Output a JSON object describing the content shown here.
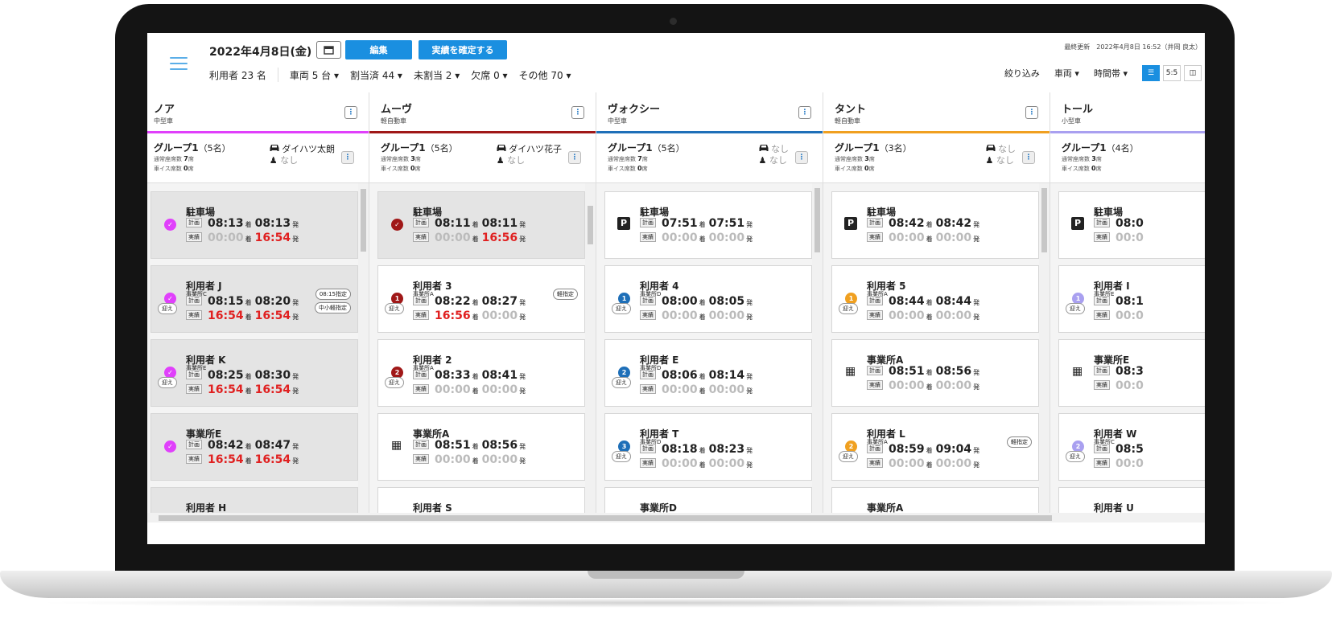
{
  "header": {
    "date": "2022年4月8日(金)",
    "edit_label": "編集",
    "confirm_label": "実績を確定する",
    "updated": "最終更新　2022年4月8日 16:52（井岡 良太）",
    "summary": {
      "users": "利用者 23 名",
      "vehicles": "車両 5 台 ▾",
      "assigned": "割当済 44 ▾",
      "unassigned": "未割当 2 ▾",
      "absent": "欠席 0 ▾",
      "other": "その他 70 ▾"
    },
    "filters": {
      "narrow": "絞り込み",
      "vehicle": "車両 ▾",
      "timeslot": "時間帯 ▾",
      "view_list": "☰",
      "view_55": "5:5",
      "view_book": "◫"
    }
  },
  "labels": {
    "plan": "計画",
    "actual": "実績",
    "arrive": "着",
    "depart": "発",
    "pickup": "迎え"
  },
  "colors": {
    "accent": "#1a8fe0",
    "red": "#e02020"
  },
  "columns": [
    {
      "name": "ノア",
      "type": "中型車",
      "color": "#e040fb",
      "group": {
        "name": "グループ1",
        "count": "（5名）",
        "normal_seats_label": "通常座席数",
        "normal_seats": "7",
        "wheel_label": "車イス席数",
        "wheel_seats": "0",
        "seat_unit": "席",
        "driver": "ダイハツ太朗",
        "helper": "なし"
      },
      "cards": [
        {
          "title": "駐車場",
          "sub": "",
          "marker": "check",
          "plan_arr": "08:13",
          "plan_dep": "08:13",
          "act_arr": "00:00",
          "act_dep": "16:54",
          "done": true
        },
        {
          "title": "利用者 J",
          "sub": "事業所C",
          "marker": "check",
          "pickup": true,
          "plan_arr": "08:15",
          "plan_dep": "08:20",
          "act_arr": "16:54",
          "act_dep": "16:54",
          "tag1": "08:15指定",
          "tag2": "中小軽指定",
          "done": true
        },
        {
          "title": "利用者 K",
          "sub": "事業所E",
          "marker": "check",
          "pickup": true,
          "plan_arr": "08:25",
          "plan_dep": "08:30",
          "act_arr": "16:54",
          "act_dep": "16:54",
          "done": true
        },
        {
          "title": "事業所E",
          "sub": "",
          "marker": "check",
          "plan_arr": "08:42",
          "plan_dep": "08:47",
          "act_arr": "16:54",
          "act_dep": "16:54",
          "done": true
        },
        {
          "title": "利用者 H",
          "sub": "",
          "marker": "check",
          "done": true
        }
      ]
    },
    {
      "name": "ムーヴ",
      "type": "軽自動車",
      "color": "#a01818",
      "group": {
        "name": "グループ1",
        "count": "（5名）",
        "normal_seats_label": "通常座席数",
        "normal_seats": "3",
        "wheel_label": "車イス席数",
        "wheel_seats": "0",
        "seat_unit": "席",
        "driver": "ダイハツ花子",
        "helper": "なし"
      },
      "cards": [
        {
          "title": "駐車場",
          "sub": "",
          "marker": "check",
          "plan_arr": "08:11",
          "plan_dep": "08:11",
          "act_arr": "00:00",
          "act_dep": "16:56",
          "done": true
        },
        {
          "title": "利用者 3",
          "sub": "事業所A",
          "marker": "1",
          "pickup": true,
          "plan_arr": "08:22",
          "plan_dep": "08:27",
          "act_arr": "16:56",
          "act_dep": "00:00",
          "tag1": "軽指定"
        },
        {
          "title": "利用者 2",
          "sub": "事業所A",
          "marker": "2",
          "pickup": true,
          "plan_arr": "08:33",
          "plan_dep": "08:41",
          "act_arr": "00:00",
          "act_dep": "00:00"
        },
        {
          "title": "事業所A",
          "sub": "",
          "marker": "building",
          "plan_arr": "08:51",
          "plan_dep": "08:56",
          "act_arr": "00:00",
          "act_dep": "00:00"
        },
        {
          "title": "利用者 S",
          "sub": "",
          "marker": "3"
        }
      ]
    },
    {
      "name": "ヴォクシー",
      "type": "中型車",
      "color": "#1e6fb8",
      "group": {
        "name": "グループ1",
        "count": "（5名）",
        "normal_seats_label": "通常座席数",
        "normal_seats": "7",
        "wheel_label": "車イス席数",
        "wheel_seats": "0",
        "seat_unit": "席",
        "driver": "なし",
        "helper": "なし"
      },
      "cards": [
        {
          "title": "駐車場",
          "sub": "",
          "marker": "parking",
          "plan_arr": "07:51",
          "plan_dep": "07:51",
          "act_arr": "00:00",
          "act_dep": "00:00"
        },
        {
          "title": "利用者 4",
          "sub": "事業所D",
          "marker": "1",
          "pickup": true,
          "plan_arr": "08:00",
          "plan_dep": "08:05",
          "act_arr": "00:00",
          "act_dep": "00:00"
        },
        {
          "title": "利用者 E",
          "sub": "事業所D",
          "marker": "2",
          "pickup": true,
          "plan_arr": "08:06",
          "plan_dep": "08:14",
          "act_arr": "00:00",
          "act_dep": "00:00"
        },
        {
          "title": "利用者 T",
          "sub": "事業所D",
          "marker": "3",
          "pickup": true,
          "plan_arr": "08:18",
          "plan_dep": "08:23",
          "act_arr": "00:00",
          "act_dep": "00:00"
        },
        {
          "title": "事業所D",
          "sub": "",
          "marker": "building"
        }
      ]
    },
    {
      "name": "タント",
      "type": "軽自動車",
      "color": "#f0a020",
      "group": {
        "name": "グループ1",
        "count": "（3名）",
        "normal_seats_label": "通常座席数",
        "normal_seats": "3",
        "wheel_label": "車イス席数",
        "wheel_seats": "0",
        "seat_unit": "席",
        "driver": "なし",
        "helper": "なし"
      },
      "cards": [
        {
          "title": "駐車場",
          "sub": "",
          "marker": "parking",
          "plan_arr": "08:42",
          "plan_dep": "08:42",
          "act_arr": "00:00",
          "act_dep": "00:00"
        },
        {
          "title": "利用者 5",
          "sub": "事業所A",
          "marker": "1",
          "pickup": true,
          "plan_arr": "08:44",
          "plan_dep": "08:44",
          "act_arr": "00:00",
          "act_dep": "00:00"
        },
        {
          "title": "事業所A",
          "sub": "",
          "marker": "building",
          "plan_arr": "08:51",
          "plan_dep": "08:56",
          "act_arr": "00:00",
          "act_dep": "00:00"
        },
        {
          "title": "利用者 L",
          "sub": "事業所A",
          "marker": "2",
          "pickup": true,
          "plan_arr": "08:59",
          "plan_dep": "09:04",
          "act_arr": "00:00",
          "act_dep": "00:00",
          "tag1": "軽指定"
        },
        {
          "title": "事業所A",
          "sub": "",
          "marker": "building"
        }
      ]
    },
    {
      "name": "トール",
      "type": "小型車",
      "color": "#a9a0f0",
      "group": {
        "name": "グループ1",
        "count": "（4名）",
        "normal_seats_label": "通常座席数",
        "normal_seats": "3",
        "wheel_label": "車イス席数",
        "wheel_seats": "0",
        "seat_unit": "席",
        "driver": "",
        "helper": ""
      },
      "cards": [
        {
          "title": "駐車場",
          "sub": "",
          "marker": "parking",
          "plan_arr": "08:0",
          "plan_dep": "",
          "act_arr": "00:0",
          "act_dep": ""
        },
        {
          "title": "利用者 I",
          "sub": "事業所E",
          "marker": "1",
          "pickup": true,
          "plan_arr": "08:1",
          "plan_dep": "",
          "act_arr": "00:0",
          "act_dep": ""
        },
        {
          "title": "事業所E",
          "sub": "",
          "marker": "building",
          "plan_arr": "08:3",
          "plan_dep": "",
          "act_arr": "00:0",
          "act_dep": ""
        },
        {
          "title": "利用者 W",
          "sub": "事業所C",
          "marker": "2",
          "pickup": true,
          "plan_arr": "08:5",
          "plan_dep": "",
          "act_arr": "00:0",
          "act_dep": ""
        },
        {
          "title": "利用者 U",
          "sub": "",
          "marker": "3"
        }
      ]
    }
  ]
}
